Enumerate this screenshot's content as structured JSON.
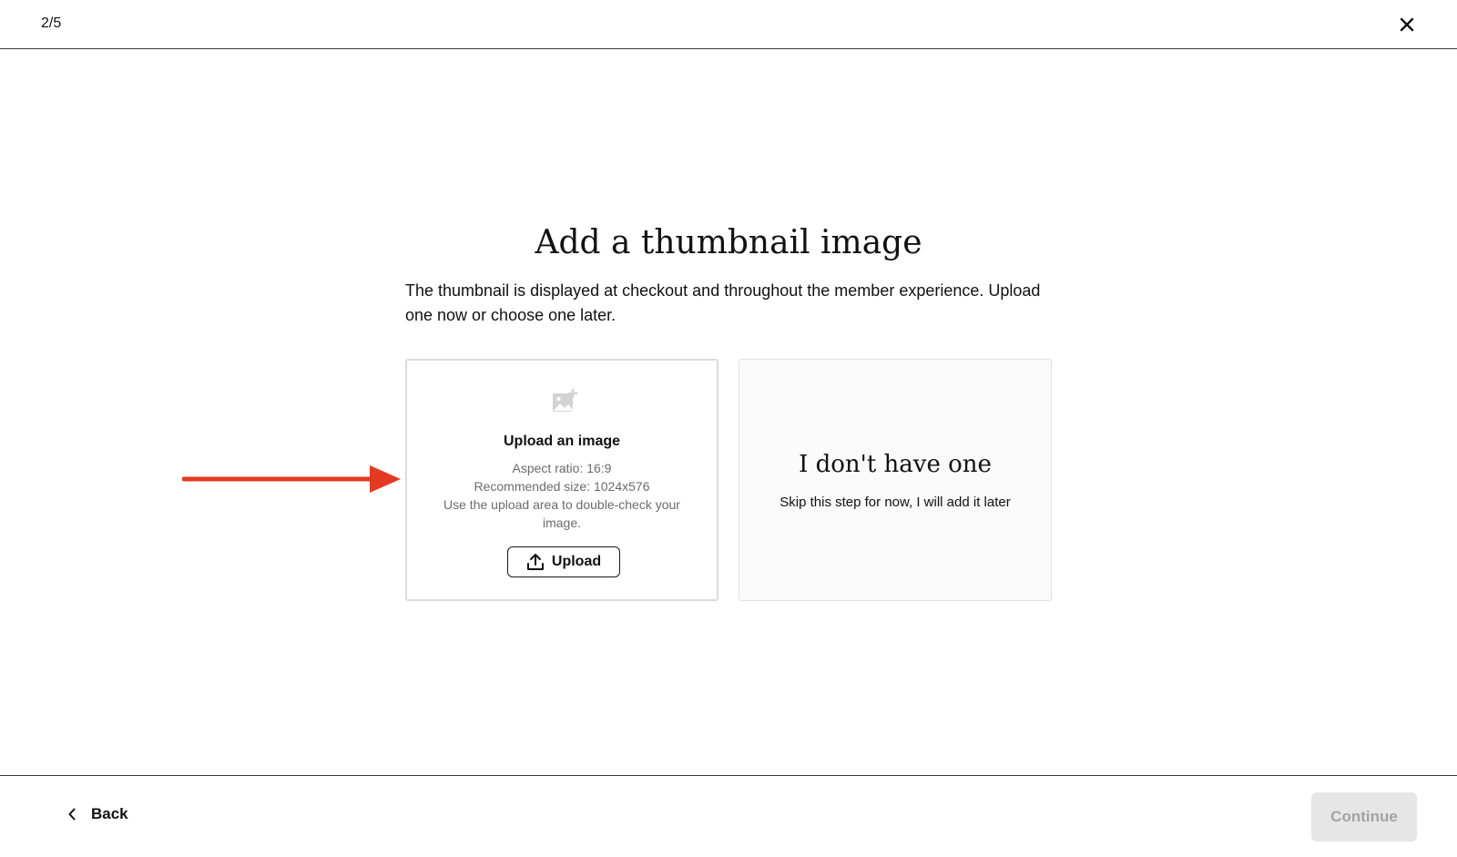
{
  "header": {
    "step": "2/5",
    "close_icon": "close-icon"
  },
  "main": {
    "title": "Add a thumbnail image",
    "description": "The thumbnail is displayed at checkout and throughout the member experience. Upload one now or choose one later."
  },
  "upload_card": {
    "icon": "add-image-icon",
    "title": "Upload an image",
    "aspect_ratio": "Aspect ratio: 16:9",
    "recommended_size": "Recommended size: 1024x576",
    "hint": "Use the upload area to double-check your image.",
    "button_label": "Upload",
    "button_icon": "upload-icon"
  },
  "skip_card": {
    "title": "I don't have one",
    "subtitle": "Skip this step for now, I will add it later"
  },
  "footer": {
    "back_label": "Back",
    "back_icon": "chevron-left-icon",
    "continue_label": "Continue"
  },
  "colors": {
    "annotation_arrow": "#e53a22",
    "continue_disabled_bg": "#e6e6e6",
    "continue_disabled_text": "#a3a3a3",
    "skip_card_bg": "#fafafa"
  }
}
